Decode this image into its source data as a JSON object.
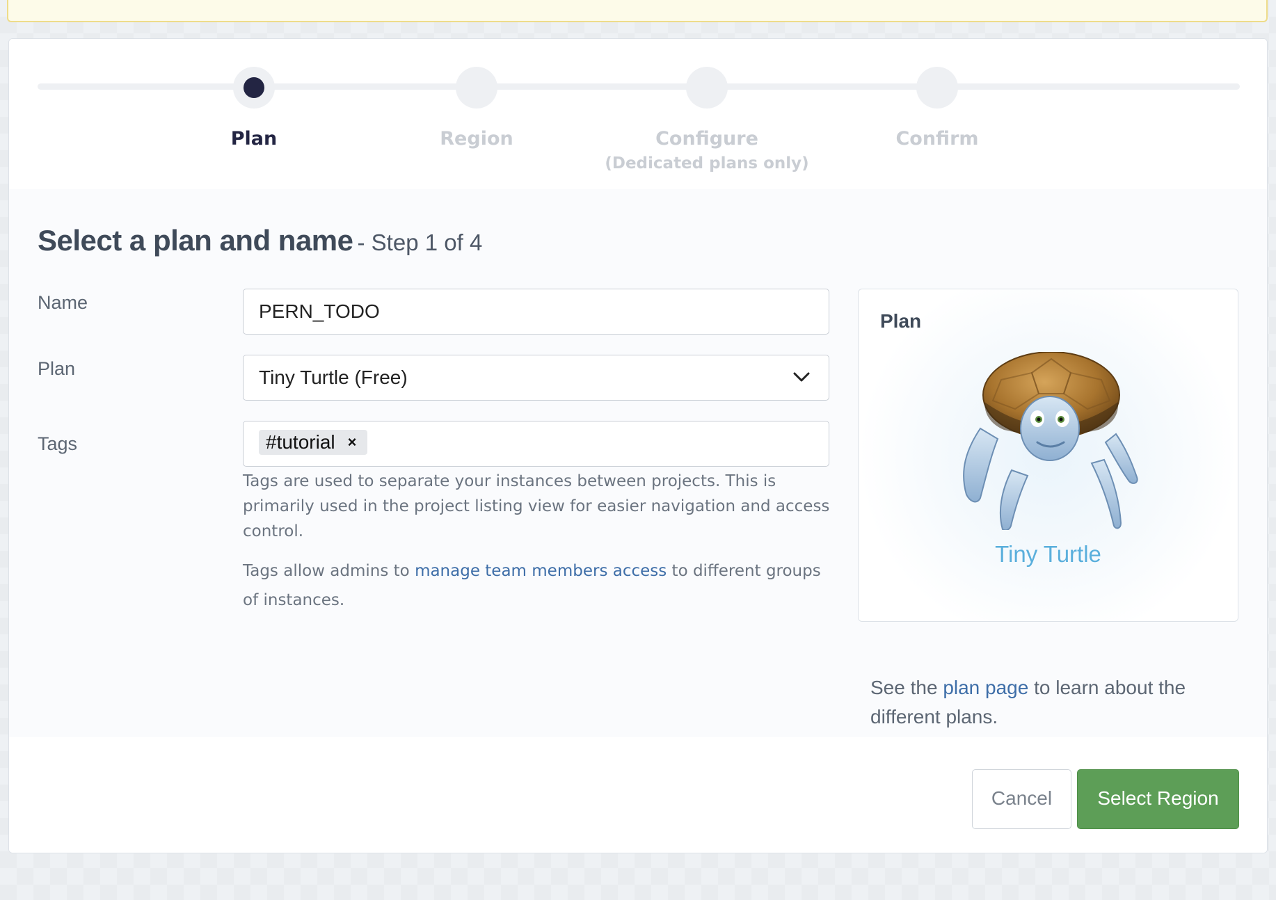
{
  "stepper": {
    "steps": [
      {
        "label": "Plan",
        "sublabel": ""
      },
      {
        "label": "Region",
        "sublabel": ""
      },
      {
        "label": "Configure",
        "sublabel": "(Dedicated plans only)"
      },
      {
        "label": "Confirm",
        "sublabel": ""
      }
    ],
    "active_index": 0
  },
  "form": {
    "heading": "Select a plan and name",
    "step_text": "- Step 1 of 4",
    "name_label": "Name",
    "name_value": "PERN_TODO",
    "plan_label": "Plan",
    "plan_value": "Tiny Turtle (Free)",
    "tags_label": "Tags",
    "tags": [
      "#tutorial"
    ],
    "tag_remove_symbol": "×",
    "tags_help_1": "Tags are used to separate your instances between projects. This is primarily used in the project listing view for easier navigation and access control.",
    "tags_help_2_pre": "Tags allow admins to ",
    "tags_help_2_link": "manage team members access",
    "tags_help_2_post": " to different groups of instances."
  },
  "plan_card": {
    "title": "Plan",
    "plan_name": "Tiny Turtle",
    "image": "tiny-turtle-mascot",
    "note_pre": "See the ",
    "note_link": "plan page",
    "note_post": " to learn about the different plans."
  },
  "footer": {
    "cancel_label": "Cancel",
    "primary_label": "Select Region"
  },
  "colors": {
    "primary_button": "#5d9e57",
    "active_step": "#232543",
    "link": "#3e6ea8",
    "plan_name": "#5aafdc",
    "notice_background": "#fdfbe9"
  }
}
